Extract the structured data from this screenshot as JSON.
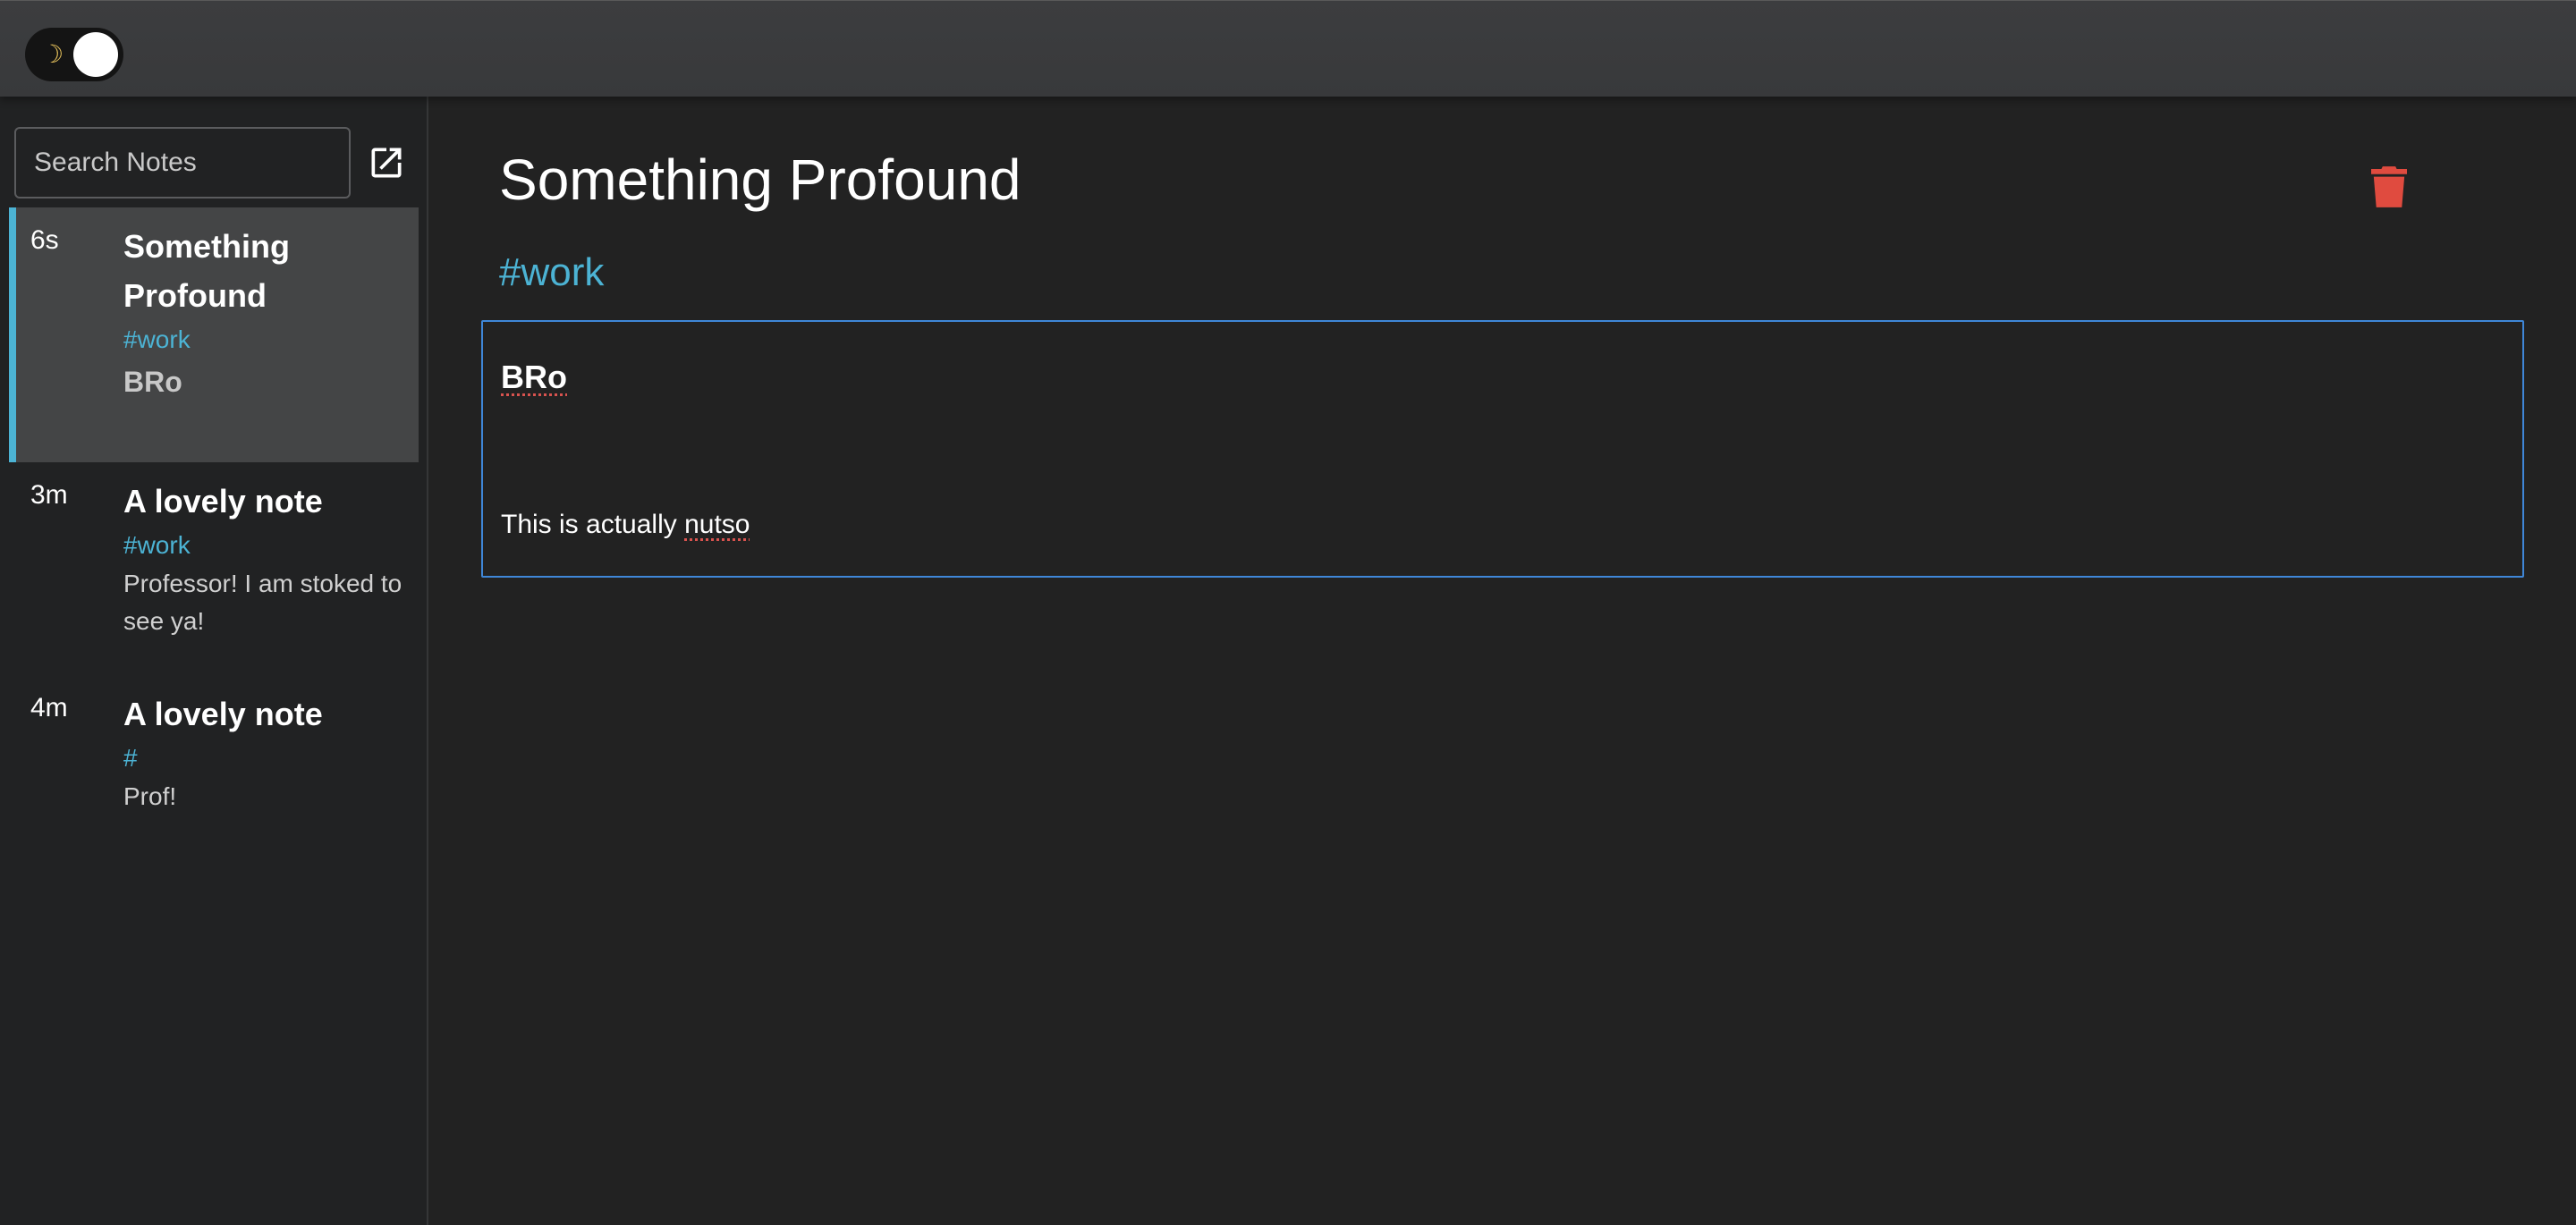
{
  "toolbar": {
    "theme_toggle_icon": "moon-icon",
    "theme_toggle_state": "dark"
  },
  "sidebar": {
    "search": {
      "placeholder": "Search Notes",
      "value": ""
    },
    "new_note_icon": "open-in-new-icon",
    "notes": [
      {
        "time": "6s",
        "title": "Something Profound",
        "tag": "#work",
        "preview": "BRo",
        "active": true
      },
      {
        "time": "3m",
        "title": "A lovely note",
        "tag": "#work",
        "preview": "Professor! I am stoked to see ya!",
        "active": false
      },
      {
        "time": "4m",
        "title": "A lovely note",
        "tag": "#",
        "preview": "Prof!",
        "active": false
      }
    ]
  },
  "editor": {
    "title": "Something Profound",
    "tag": "#work",
    "delete_icon": "trash-icon",
    "content": {
      "heading": "BRo",
      "line_prefix": "This is actually ",
      "line_misspelled": "nutso"
    }
  },
  "colors": {
    "accent": "#4cb3d4",
    "delete": "#e04b3f",
    "focus_border": "#3f87d8",
    "background": "#222222",
    "active_item": "#444546"
  }
}
